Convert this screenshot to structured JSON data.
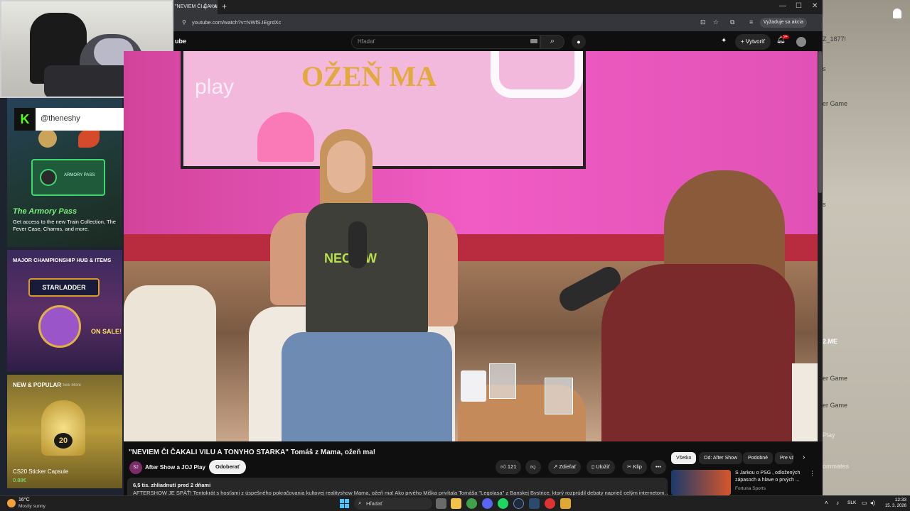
{
  "browser": {
    "tab_title": "\"NEVIEM ČI ČAKALI V",
    "new_tab_label": "+",
    "window_min": "—",
    "window_max": "☐",
    "window_close": "✕",
    "url": "youtube.com/watch?v=NWfS.IEgrdXc",
    "reload_prompt": "Vyžaduje sa akcia"
  },
  "youtube": {
    "logo_text": "ube",
    "search_placeholder": "Hľadať",
    "create_label": "Vytvoriť",
    "notif_badge": "9+",
    "video": {
      "show_sign": "OŽEŇ MA",
      "screen_text": "play",
      "shirt_text": "NEON W"
    },
    "title": "\"NEVIEM ČI ČAKALI VILU A TONYHO STARKA\" Tomáš z Mama, ožeň ma!",
    "channel_avatar": "S2",
    "channel_name": "After Show a JOJ Play",
    "subscribe": "Odoberať",
    "like_count": "121",
    "share": "Zdieľať",
    "save": "Uložiť",
    "clip": "Klip",
    "more": "•••",
    "desc_meta": "6,5 tis. zhliadnutí  pred 2 dňami",
    "desc_text": "AFTERSHOW JE SPÄŤ! Tentokrát s hosťami z úspešného pokračovania kultovej realityshow Mama, ožeň ma! Ako prvého Miška privítala Tomáša \"Legolasa\" z Banskej Bystrice, ktorý rozprúdil debaty naprieč celým internetom. A máme pre",
    "chips": [
      "Všetko",
      "Od: After Show",
      "Podobné",
      "Pre vás"
    ],
    "rec_title": "S Jarkou o PSG , odložených zápasoch a hlave o prvých ...",
    "rec_channel": "Fortuna Sports"
  },
  "stream": {
    "kick_logo": "K",
    "handle": "@theneshy"
  },
  "cs_panel": {
    "armory_title": "The Armory Pass",
    "armory_desc": "Get access to the new Train Collection, The Fever Case, Charms, and more.",
    "armory_pass_label": "ARMORY PASS",
    "major_title": "MAJOR CHAMPIONSHIP HUB & ITEMS",
    "major_logo": "STARLADDER",
    "major_sale": "ON SALE!",
    "new_title": "NEW & POPULAR",
    "new_see_more": "See More",
    "capsule_name": "CS20 Sticker Capsule",
    "capsule_price": "0.88€",
    "capsule_badge": "20"
  },
  "wallpaper_labels": [
    {
      "text": "Z_1877!",
      "dim": false
    },
    {
      "text": "s",
      "dim": false
    },
    {
      "text": "er Game",
      "dim": false
    },
    {
      "text": "s",
      "dim": false
    },
    {
      "text": "2.ME",
      "dim": false
    },
    {
      "text": "er Game",
      "dim": false
    },
    {
      "text": "er Game",
      "dim": false
    },
    {
      "text": "Play",
      "dim": true
    },
    {
      "text": "ommates",
      "dim": true
    }
  ],
  "taskbar": {
    "temp": "16°C",
    "weather": "Mostly sunny",
    "search_placeholder": "Hľadať",
    "lang": "SLK",
    "time": "12:33",
    "date": "15. 3. 2026"
  },
  "colors": {
    "video_pink": "#e64fb8",
    "kick_green": "#53fc18",
    "yt_red": "#cc0000"
  }
}
